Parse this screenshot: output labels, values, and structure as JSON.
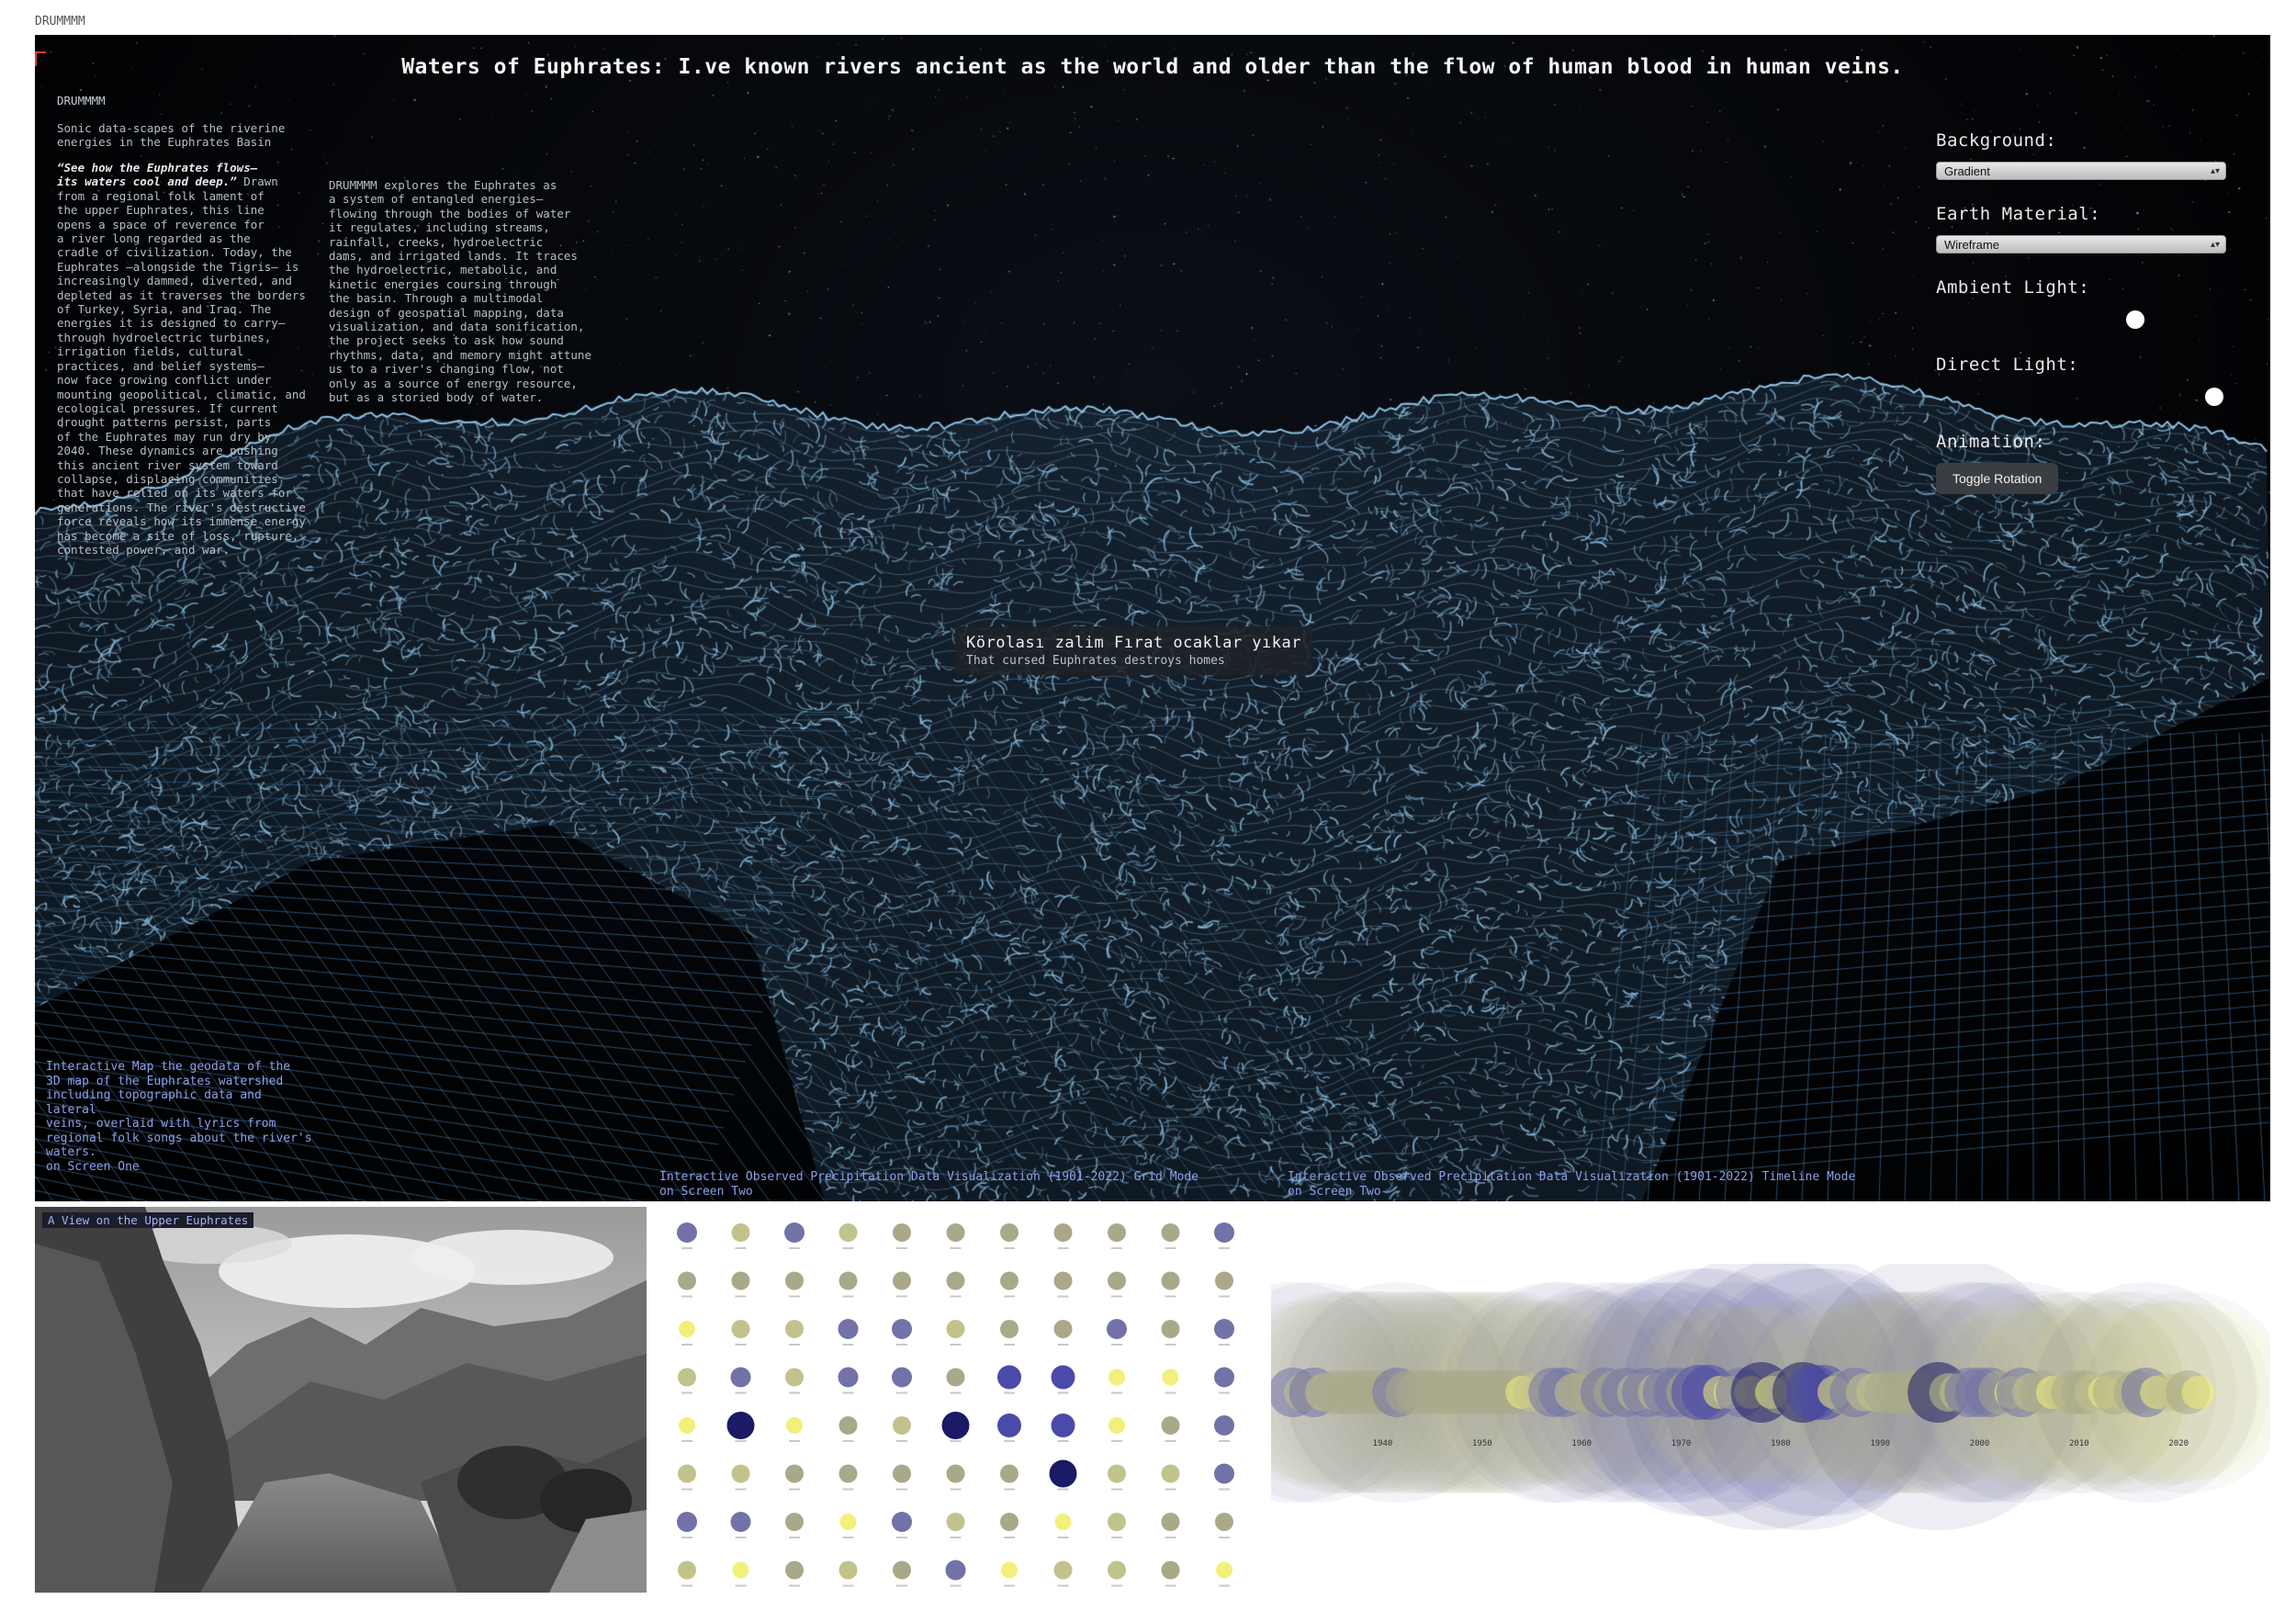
{
  "top_mark": "DRUMMMM",
  "title": "Waters of Euphrates: I.ve known rivers ancient as the world and older than the flow of human blood in human veins.",
  "sidebar": {
    "brand": "DRUMMMM",
    "subtitle": "Sonic data-scapes of the riverine\nenergies in the Euphrates Basin",
    "quote": "“See how the Euphrates flows–\nits waters cool and deep.”",
    "col1": " Drawn\nfrom a regional folk lament of\nthe upper Euphrates, this line\nopens a space of reverence for\na river long regarded as the\ncradle of civilization. Today, the\nEuphrates —alongside the Tigris— is\nincreasingly dammed, diverted, and\ndepleted as it traverses the borders\nof Turkey, Syria, and Iraq. The\nenergies it is designed to carry—\nthrough hydroelectric turbines,\nirrigation fields, cultural\npractices, and belief systems—\nnow face growing conflict under\nmounting geopolitical, climatic, and\necological pressures. If current\ndrought patterns persist, parts\nof the Euphrates may run dry by\n2040. These dynamics are pushing\nthis ancient river system toward\ncollapse, displacing communities\nthat have relied on its waters for\ngenerations. The river's destructive\nforce reveals how its immense energy\nhas become a site of loss, rupture,\ncontested power, and war.",
    "col2": "DRUMMMM explores the Euphrates as\na system of entangled energies—\nflowing through the bodies of water\nit regulates, including streams,\nrainfall, creeks, hydroelectric\ndams, and irrigated lands. It traces\nthe hydroelectric, metabolic, and\nkinetic energies coursing through\nthe basin. Through a multimodal\ndesign of geospatial mapping, data\nvisualization, and data sonification,\nthe project seeks to ask how sound\nrhythms, data, and memory might attune\nus to a river's changing flow, not\nonly as a source of energy resource,\nbut as a storied body of water."
  },
  "controls": {
    "background": {
      "label": "Background:",
      "value": "Gradient"
    },
    "earth_material": {
      "label": "Earth Material:",
      "value": "Wireframe"
    },
    "ambient_light": {
      "label": "Ambient Light:",
      "level": 0.7
    },
    "direct_light": {
      "label": "Direct Light:",
      "level": 0.99
    },
    "animation": {
      "label": "Animation:",
      "button": "Toggle Rotation"
    }
  },
  "lyric": {
    "line": "Körolası zalim Fırat ocaklar yıkar",
    "translation": "That cursed Euphrates destroys homes"
  },
  "captions": {
    "map": " Interactive Map the geodata of the\n3D map of the Euphrates watershed\nincluding topographic data and lateral\nveins, overlaid with lyrics from\nregional folk songs about the river's\nwaters.\n on Screen One",
    "grid": "Interactive Observed Precipitation Data Visualization (1901-2022) Grid Mode\non Screen Two",
    "timeline": "Interactive Observed Precipitation Data Visualization (1901-2022) Timeline Mode\non Screen Two",
    "photo": "A View on the Upper Euphrates"
  },
  "colors": {
    "wire": "#8fc3e6",
    "dry": "#f2f07a",
    "mid": "#a9a98a",
    "wet": "#4a4aa8",
    "very_wet": "#1a1a66"
  },
  "chart_data": [
    {
      "type": "scatter",
      "mode": "grid",
      "columns": 11,
      "rows": 8,
      "levels": [
        3,
        1,
        3,
        1,
        2,
        2,
        2,
        2,
        2,
        2,
        3,
        2,
        2,
        2,
        2,
        2,
        2,
        2,
        2,
        2,
        2,
        2,
        0,
        1,
        1,
        3,
        3,
        1,
        2,
        2,
        3,
        2,
        3,
        1,
        3,
        1,
        3,
        3,
        2,
        4,
        4,
        0,
        0,
        3,
        0,
        5,
        0,
        2,
        1,
        5,
        4,
        4,
        0,
        2,
        3,
        1,
        1,
        2,
        2,
        2,
        2,
        2,
        5,
        1,
        1,
        3,
        3,
        3,
        2,
        0,
        3,
        1,
        2,
        0,
        1,
        2,
        2,
        1,
        0,
        2,
        1,
        2,
        3,
        0,
        1,
        1,
        2,
        0
      ]
    },
    {
      "type": "scatter",
      "mode": "timeline",
      "x_ticks": [
        "1940",
        "1950",
        "1960",
        "1970",
        "1980",
        "1990",
        "2000",
        "2010",
        "2020"
      ],
      "x_range": [
        1931,
        2027
      ]
    }
  ]
}
